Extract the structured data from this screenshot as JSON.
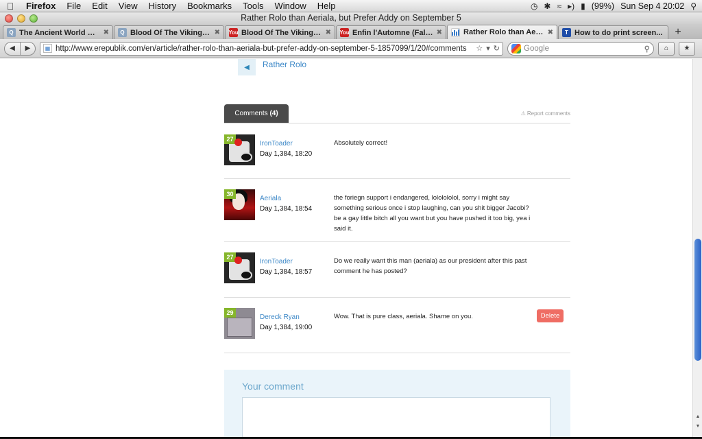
{
  "menubar": {
    "app_name": "Firefox",
    "items": [
      "File",
      "Edit",
      "View",
      "History",
      "Bookmarks",
      "Tools",
      "Window",
      "Help"
    ],
    "battery": "(99%)",
    "datetime": "Sun Sep 4  20:02",
    "icons": [
      "apple-icon",
      "time-machine-icon",
      "bluetooth-icon",
      "wifi-icon",
      "volume-icon",
      "battery-icon",
      "spotlight-icon"
    ]
  },
  "window": {
    "title": "Rather Rolo than Aeriala, but Prefer Addy on September 5"
  },
  "tabs": [
    {
      "label": "The Ancient World With...",
      "favicon": "Q",
      "active": false
    },
    {
      "label": "Blood Of The Vikings(b...",
      "favicon": "Q",
      "active": false
    },
    {
      "label": "Blood Of The Vikings -...",
      "favicon": "You",
      "active": false
    },
    {
      "label": "Enfin l'Automne (Fall, Fi...",
      "favicon": "You",
      "active": false
    },
    {
      "label": "Rather Rolo than Aerial...",
      "favicon": "e",
      "active": true
    },
    {
      "label": "How to do print screen...",
      "favicon": "T",
      "active": false
    }
  ],
  "navbar": {
    "url": "http://www.erepublik.com/en/article/rather-rolo-than-aeriala-but-prefer-addy-on-september-5-1857099/1/20#comments",
    "search_placeholder": "Google"
  },
  "page": {
    "article_nav_link": "Rather Rolo",
    "comments_tab_label": "Comments",
    "comments_count": "(4)",
    "report_link": "Report comments",
    "your_comment_heading": "Your comment",
    "delete_label": "Delete",
    "comments": [
      {
        "level": "27",
        "user": "IronToader",
        "date": "Day 1,384, 18:20",
        "text": "Absolutely correct!",
        "avatar": "pirate"
      },
      {
        "level": "30",
        "user": "Aeriala",
        "date": "Day 1,384, 18:54",
        "text": "the foriegn support i endangered, lololololol, sorry i might say something serious once i stop laughing, can you shit bigger Jacobi? be a gay little bitch all you want but you have pushed it too big, yea i said it.",
        "avatar": "geisha"
      },
      {
        "level": "27",
        "user": "IronToader",
        "date": "Day 1,384, 18:57",
        "text": "Do we really want this man (aeriala) as our president after this past comment he has posted?",
        "avatar": "pirate"
      },
      {
        "level": "29",
        "user": "Dereck Ryan",
        "date": "Day 1,384, 19:00",
        "text": "Wow. That is pure class, aeriala. Shame on you.",
        "avatar": "sketch"
      }
    ]
  },
  "colors": {
    "link_blue": "#3b87c7",
    "level_green": "#86b62b",
    "delete_red": "#ef6d64",
    "comment_box_bg": "#eaf4fa",
    "tab_dark": "#4a4a4a"
  }
}
